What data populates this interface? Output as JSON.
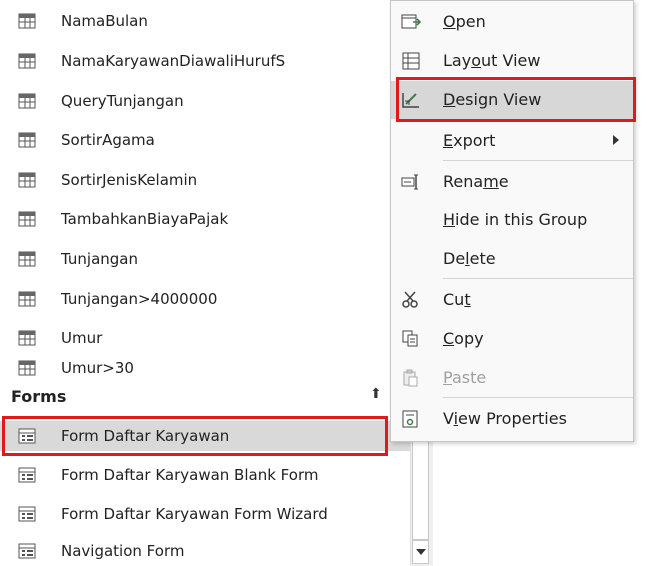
{
  "nav": {
    "queries": [
      "NamaBulan",
      "NamaKaryawanDiawaliHurufS",
      "QueryTunjangan",
      "SortirAgama",
      "SortirJenisKelamin",
      "TambahkanBiayaPajak",
      "Tunjangan",
      "Tunjangan>4000000",
      "Umur",
      "Umur>30"
    ],
    "forms_header": "Forms",
    "forms_chevron": "≈",
    "forms": [
      "Form Daftar Karyawan",
      "Form Daftar Karyawan Blank Form",
      "Form Daftar Karyawan Form Wizard",
      "Navigation Form"
    ]
  },
  "menu": {
    "open": {
      "pre": "",
      "key": "O",
      "post": "pen"
    },
    "layout": {
      "pre": "Lay",
      "key": "o",
      "post": "ut View"
    },
    "design": {
      "pre": "",
      "key": "D",
      "post": "esign View"
    },
    "export": {
      "pre": "",
      "key": "E",
      "post": "xport"
    },
    "rename": {
      "pre": "Rena",
      "key": "m",
      "post": "e"
    },
    "hide": {
      "pre": "",
      "key": "H",
      "post": "ide in this Group"
    },
    "delete": {
      "pre": "De",
      "key": "l",
      "post": "ete"
    },
    "cut": {
      "pre": "Cu",
      "key": "t",
      "post": ""
    },
    "copy": {
      "pre": "",
      "key": "C",
      "post": "opy"
    },
    "paste": {
      "pre": "",
      "key": "P",
      "post": "aste"
    },
    "props": {
      "pre": "V",
      "key": "i",
      "post": "ew Properties"
    }
  },
  "colors": {
    "highlight_box": "#e0191a",
    "selected_bg": "#d9d9d9",
    "menu_hover": "#d7d7d7",
    "icon_green": "#3f7d4e"
  }
}
